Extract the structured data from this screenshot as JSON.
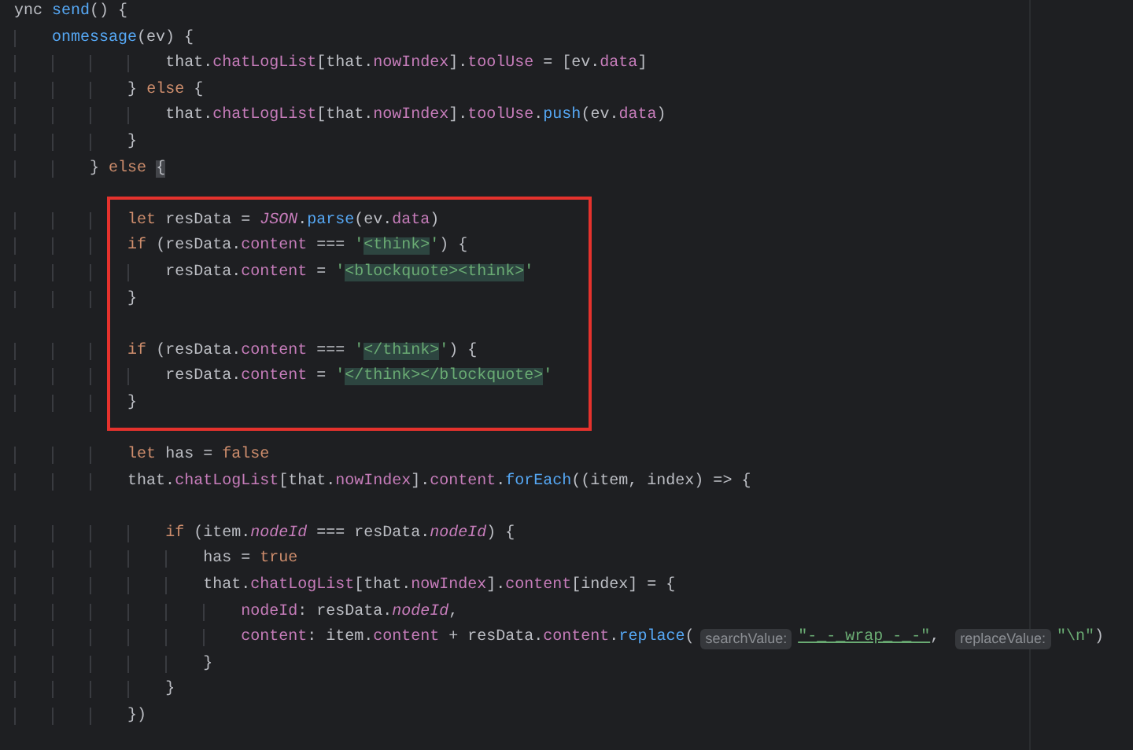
{
  "editor": {
    "blocks": [
      {
        "boxed": false,
        "lines": [
          {
            "kind": "code",
            "tokens": [
              {
                "kind": "text",
                "text": "ync "
              },
              {
                "kind": "fn",
                "text": "send"
              },
              {
                "kind": "text",
                "text": "() {"
              }
            ]
          },
          {
            "kind": "code",
            "tokens": [
              {
                "kind": "fn",
                "text": "    onmessage"
              },
              {
                "kind": "text",
                "text": "(ev) {"
              }
            ]
          },
          {
            "kind": "code",
            "tokens": [
              {
                "kind": "text",
                "text": "                that."
              },
              {
                "kind": "prop",
                "text": "chatLogList"
              },
              {
                "kind": "text",
                "text": "[that."
              },
              {
                "kind": "prop",
                "text": "nowIndex"
              },
              {
                "kind": "text",
                "text": "]."
              },
              {
                "kind": "prop",
                "text": "toolUse"
              },
              {
                "kind": "text",
                "text": " = [ev."
              },
              {
                "kind": "prop",
                "text": "data"
              },
              {
                "kind": "text",
                "text": "]"
              }
            ]
          },
          {
            "kind": "code",
            "tokens": [
              {
                "kind": "text",
                "text": "            } "
              },
              {
                "kind": "kw",
                "text": "else"
              },
              {
                "kind": "text",
                "text": " {"
              }
            ]
          },
          {
            "kind": "code",
            "tokens": [
              {
                "kind": "text",
                "text": "                that."
              },
              {
                "kind": "prop",
                "text": "chatLogList"
              },
              {
                "kind": "text",
                "text": "[that."
              },
              {
                "kind": "prop",
                "text": "nowIndex"
              },
              {
                "kind": "text",
                "text": "]."
              },
              {
                "kind": "prop",
                "text": "toolUse"
              },
              {
                "kind": "text",
                "text": "."
              },
              {
                "kind": "fn",
                "text": "push"
              },
              {
                "kind": "text",
                "text": "(ev."
              },
              {
                "kind": "prop",
                "text": "data"
              },
              {
                "kind": "text",
                "text": ")"
              }
            ]
          },
          {
            "kind": "code",
            "tokens": [
              {
                "kind": "text",
                "text": "            }"
              }
            ]
          },
          {
            "kind": "code",
            "tokens": [
              {
                "kind": "text",
                "text": "        } "
              },
              {
                "kind": "kw",
                "text": "else "
              },
              {
                "kind": "match",
                "text": "{"
              }
            ]
          },
          {
            "kind": "blank"
          }
        ]
      },
      {
        "boxed": true,
        "lines": [
          {
            "kind": "code",
            "tokens": [
              {
                "kind": "kw",
                "text": "            let"
              },
              {
                "kind": "text",
                "text": " resData = "
              },
              {
                "kind": "italic",
                "text": "JSON"
              },
              {
                "kind": "text",
                "text": "."
              },
              {
                "kind": "fn",
                "text": "parse"
              },
              {
                "kind": "text",
                "text": "(ev."
              },
              {
                "kind": "prop",
                "text": "data"
              },
              {
                "kind": "text",
                "text": ")"
              }
            ]
          },
          {
            "kind": "code",
            "tokens": [
              {
                "kind": "kw",
                "text": "            if"
              },
              {
                "kind": "text",
                "text": " (resData."
              },
              {
                "kind": "prop",
                "text": "content"
              },
              {
                "kind": "text",
                "text": " === "
              },
              {
                "kind": "str",
                "text": "'"
              },
              {
                "kind": "hl",
                "text": "<think>"
              },
              {
                "kind": "str",
                "text": "'"
              },
              {
                "kind": "text",
                "text": ") {"
              }
            ]
          },
          {
            "kind": "code",
            "tokens": [
              {
                "kind": "text",
                "text": "                resData."
              },
              {
                "kind": "prop",
                "text": "content"
              },
              {
                "kind": "text",
                "text": " = "
              },
              {
                "kind": "str",
                "text": "'"
              },
              {
                "kind": "hl",
                "text": "<blockquote><think>"
              },
              {
                "kind": "str",
                "text": "'"
              }
            ]
          },
          {
            "kind": "code",
            "tokens": [
              {
                "kind": "text",
                "text": "            }"
              }
            ]
          },
          {
            "kind": "blank"
          },
          {
            "kind": "code",
            "tokens": [
              {
                "kind": "kw",
                "text": "            if"
              },
              {
                "kind": "text",
                "text": " (resData."
              },
              {
                "kind": "prop",
                "text": "content"
              },
              {
                "kind": "text",
                "text": " === "
              },
              {
                "kind": "str",
                "text": "'"
              },
              {
                "kind": "hl",
                "text": "</think>"
              },
              {
                "kind": "str",
                "text": "'"
              },
              {
                "kind": "text",
                "text": ") {"
              }
            ]
          },
          {
            "kind": "code",
            "tokens": [
              {
                "kind": "text",
                "text": "                resData."
              },
              {
                "kind": "prop",
                "text": "content"
              },
              {
                "kind": "text",
                "text": " = "
              },
              {
                "kind": "str",
                "text": "'"
              },
              {
                "kind": "hl",
                "text": "</think></blockquote>"
              },
              {
                "kind": "str",
                "text": "'"
              }
            ]
          },
          {
            "kind": "code",
            "tokens": [
              {
                "kind": "text",
                "text": "            }"
              }
            ]
          }
        ]
      },
      {
        "boxed": false,
        "lines": [
          {
            "kind": "blank"
          },
          {
            "kind": "code",
            "tokens": [
              {
                "kind": "kw",
                "text": "            let"
              },
              {
                "kind": "text",
                "text": " has = "
              },
              {
                "kind": "kw",
                "text": "false"
              }
            ]
          },
          {
            "kind": "code",
            "tokens": [
              {
                "kind": "text",
                "text": "            that."
              },
              {
                "kind": "prop",
                "text": "chatLogList"
              },
              {
                "kind": "text",
                "text": "[that."
              },
              {
                "kind": "prop",
                "text": "nowIndex"
              },
              {
                "kind": "text",
                "text": "]."
              },
              {
                "kind": "prop",
                "text": "content"
              },
              {
                "kind": "text",
                "text": "."
              },
              {
                "kind": "fn",
                "text": "forEach"
              },
              {
                "kind": "text",
                "text": "((item, index) => {"
              }
            ]
          },
          {
            "kind": "blank"
          },
          {
            "kind": "code",
            "tokens": [
              {
                "kind": "kw",
                "text": "                if"
              },
              {
                "kind": "text",
                "text": " (item."
              },
              {
                "kind": "italic",
                "text": "nodeId"
              },
              {
                "kind": "text",
                "text": " === resData."
              },
              {
                "kind": "italic",
                "text": "nodeId"
              },
              {
                "kind": "text",
                "text": ") {"
              }
            ]
          },
          {
            "kind": "code",
            "tokens": [
              {
                "kind": "text",
                "text": "                    has = "
              },
              {
                "kind": "kw",
                "text": "true"
              }
            ]
          },
          {
            "kind": "code",
            "tokens": [
              {
                "kind": "text",
                "text": "                    that."
              },
              {
                "kind": "prop",
                "text": "chatLogList"
              },
              {
                "kind": "text",
                "text": "[that."
              },
              {
                "kind": "prop",
                "text": "nowIndex"
              },
              {
                "kind": "text",
                "text": "]."
              },
              {
                "kind": "prop",
                "text": "content"
              },
              {
                "kind": "text",
                "text": "[index] = {"
              }
            ]
          },
          {
            "kind": "code",
            "tokens": [
              {
                "kind": "prop",
                "text": "                        nodeId"
              },
              {
                "kind": "text",
                "text": ": resData."
              },
              {
                "kind": "italic",
                "text": "nodeId"
              },
              {
                "kind": "text",
                "text": ","
              }
            ]
          },
          {
            "kind": "code",
            "tokens": [
              {
                "kind": "prop",
                "text": "                        content"
              },
              {
                "kind": "text",
                "text": ": item."
              },
              {
                "kind": "prop",
                "text": "content"
              },
              {
                "kind": "text",
                "text": " + resData."
              },
              {
                "kind": "prop",
                "text": "content"
              },
              {
                "kind": "text",
                "text": "."
              },
              {
                "kind": "fn",
                "text": "replace"
              },
              {
                "kind": "text",
                "text": "("
              },
              {
                "kind": "hint",
                "text": "searchValue:"
              },
              {
                "kind": "strul",
                "text": "\"-_-_wrap_-_-\""
              },
              {
                "kind": "text",
                "text": ", "
              },
              {
                "kind": "hint",
                "text": "replaceValue:"
              },
              {
                "kind": "str",
                "text": "\"\\n\""
              },
              {
                "kind": "text",
                "text": ")"
              }
            ]
          },
          {
            "kind": "code",
            "tokens": [
              {
                "kind": "text",
                "text": "                    }"
              }
            ]
          },
          {
            "kind": "code",
            "tokens": [
              {
                "kind": "text",
                "text": "                }"
              }
            ]
          },
          {
            "kind": "code",
            "tokens": [
              {
                "kind": "text",
                "text": "            })"
              }
            ]
          }
        ]
      }
    ]
  }
}
